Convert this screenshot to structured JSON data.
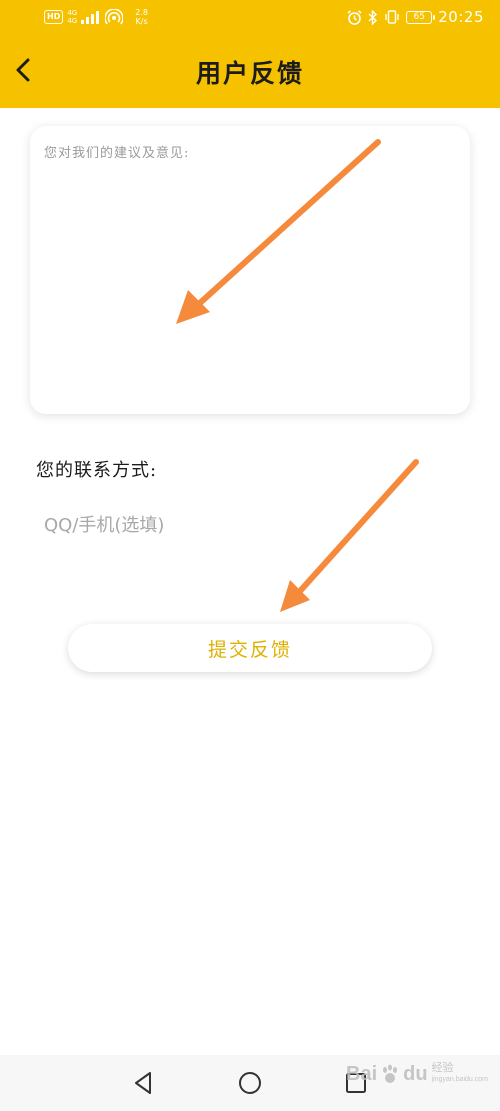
{
  "status_bar": {
    "hd_badge": "HD",
    "network_type_top": "4G",
    "network_type_bottom": "4G",
    "speed_value": "2.8",
    "speed_unit": "K/s",
    "battery_level": "65",
    "time": "20:25"
  },
  "header": {
    "title": "用户反馈",
    "background_color": "#f6c200"
  },
  "feedback": {
    "placeholder": "您对我们的建议及意见:",
    "value": ""
  },
  "contact": {
    "label": "您的联系方式:",
    "placeholder": "QQ/手机(选填)",
    "value": ""
  },
  "submit": {
    "label": "提交反馈",
    "color": "#e0b000"
  },
  "annotation": {
    "arrow_color": "#f58a3c"
  },
  "nav_bar": {
    "back_icon": "triangle-back-icon",
    "home_icon": "circle-home-icon",
    "recents_icon": "square-recents-icon"
  },
  "watermark": {
    "brand": "Bai",
    "brand_suffix": "du",
    "sub_line": "经验",
    "sub_line_2": "jingyan.baidu.com"
  }
}
